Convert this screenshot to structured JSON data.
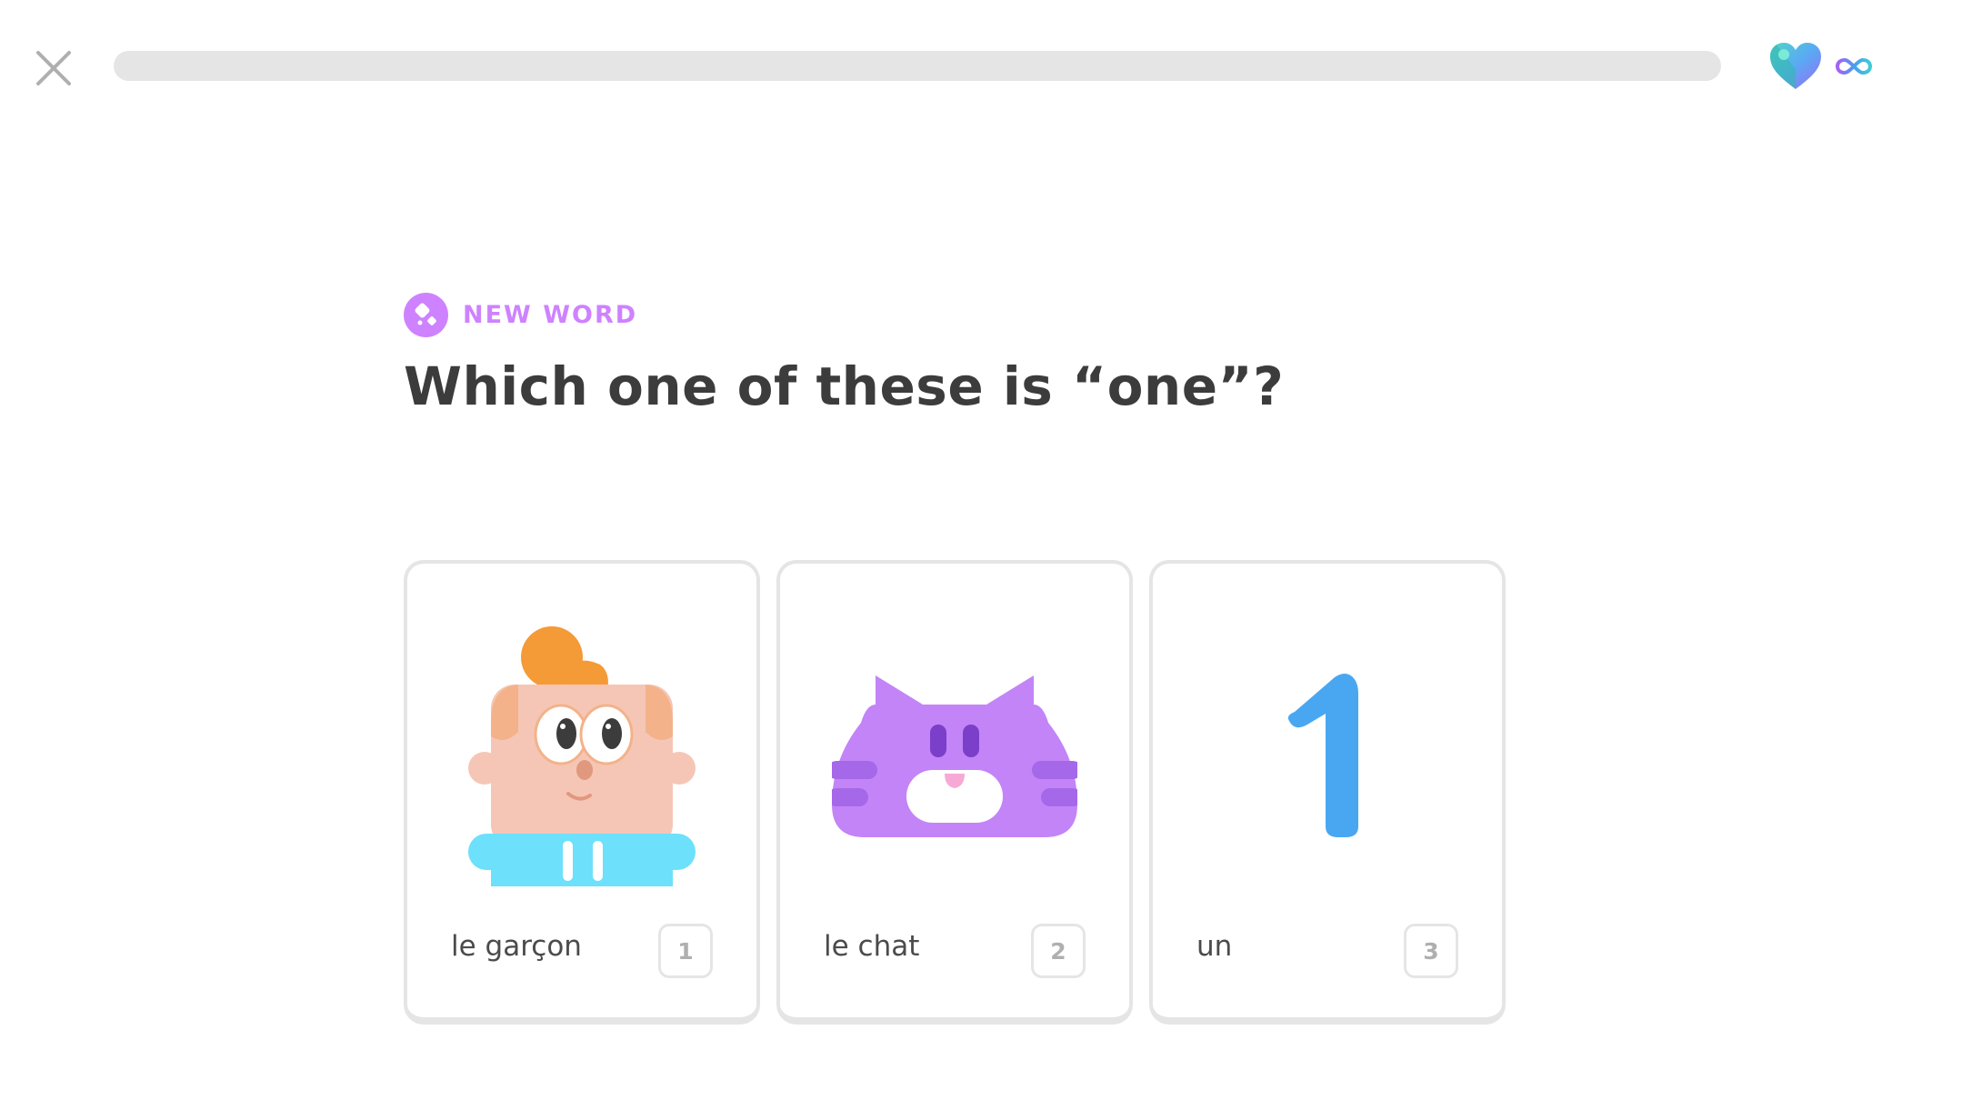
{
  "progress": 0,
  "lives": {
    "label": "∞",
    "heart_icon": "gem-heart-icon",
    "infinity_icon": "infinity-icon"
  },
  "challenge": {
    "badge_icon": "new-word-icon",
    "badge_label": "NEW WORD",
    "prompt": "Which one of these is “one”?"
  },
  "choices": [
    {
      "label": "le garçon",
      "key": "1",
      "image": "boy-illustration"
    },
    {
      "label": "le chat",
      "key": "2",
      "image": "cat-illustration"
    },
    {
      "label": "un",
      "key": "3",
      "image": "number-one-illustration"
    }
  ],
  "colors": {
    "accent": "#ce82ff",
    "text": "#3c3c3c",
    "border": "#e5e5e5",
    "number_blue": "#49a7f2",
    "cat_purple": "#c384f7",
    "boy_hair": "#f49a36",
    "boy_shirt": "#6de0fb"
  }
}
